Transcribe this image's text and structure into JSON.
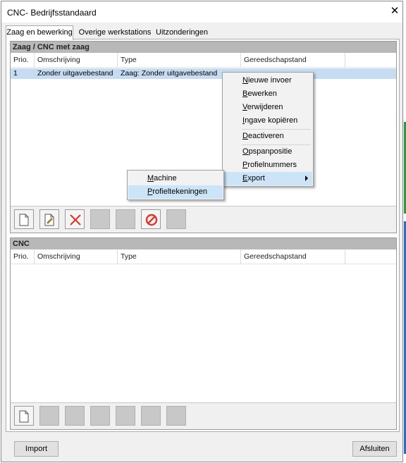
{
  "window": {
    "title": "CNC- Bedrijfsstandaard"
  },
  "tabs": [
    {
      "label": "Zaag en bewerking"
    },
    {
      "label": "Overige werkstations"
    },
    {
      "label": "Uitzonderingen"
    }
  ],
  "panel1": {
    "title": "Zaag / CNC met zaag",
    "columns": [
      "Prio.",
      "Omschrijving",
      "Type",
      "Gereedschapstand"
    ],
    "rows": [
      {
        "prio": "1",
        "omschrijving": "Zonder uitgavebestand",
        "type": "Zaag: Zonder uitgavebestand",
        "gereedschapstand": ""
      }
    ]
  },
  "panel2": {
    "title": "CNC",
    "columns": [
      "Prio.",
      "Omschrijving",
      "Type",
      "Gereedschapstand"
    ]
  },
  "context_menu": {
    "items": [
      {
        "label": "Nieuwe invoer",
        "icon": ""
      },
      {
        "label": "Bewerken"
      },
      {
        "label": "Verwijderen"
      },
      {
        "label": "Ingave kopiëren"
      },
      {
        "label": "Deactiveren"
      },
      {
        "label": "Opspanpositie"
      },
      {
        "label": "Profielnummers"
      },
      {
        "label": "Export"
      }
    ]
  },
  "submenu": {
    "items": [
      {
        "label": "Machine"
      },
      {
        "label": "Profieltekeningen"
      }
    ]
  },
  "buttons": {
    "import": "Import",
    "close": "Afsluiten"
  },
  "colors": {
    "selection": "#c5dcf2",
    "menu_highlight": "#cce4f7",
    "panel_header": "#b8b8b8",
    "delete_icon": "#e0342a"
  }
}
